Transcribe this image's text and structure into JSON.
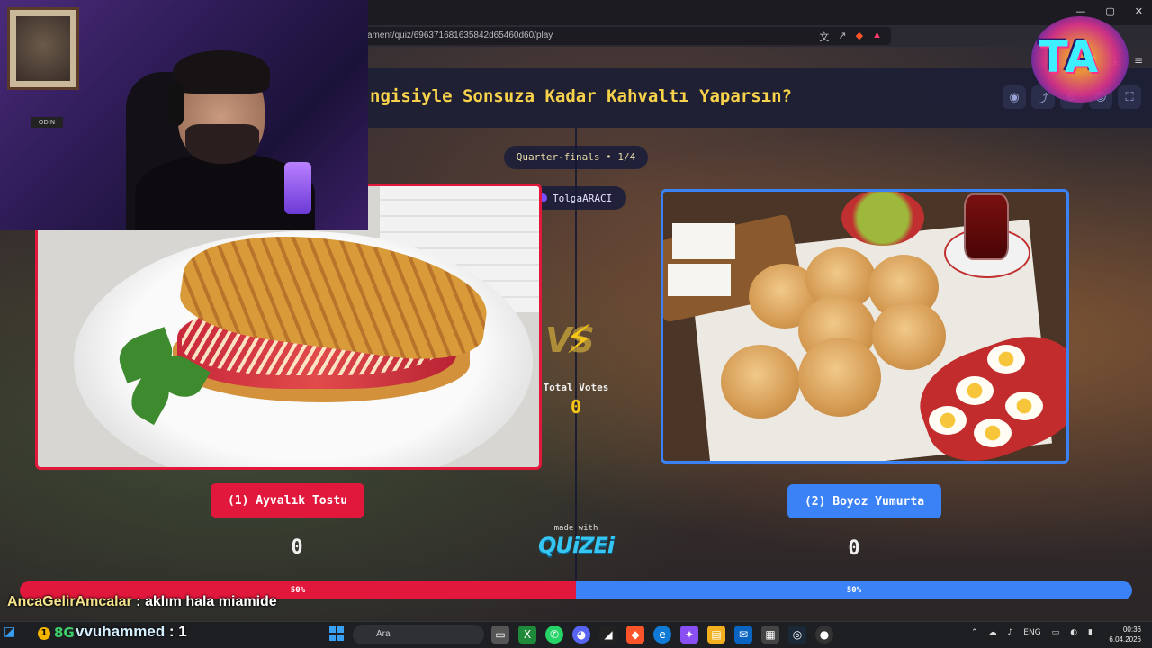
{
  "browser": {
    "url": "ament/quiz/696371681635842d65460d60/play",
    "icons": [
      "translate-icon",
      "share-icon",
      "brave-icon",
      "triangle-icon"
    ],
    "window_controls": [
      "—",
      "▢",
      "✕"
    ]
  },
  "quiz": {
    "title": "ngisiyle Sonsuza Kadar Kahvaltı Yaparsın?",
    "round": "Quarter-finals • 1/4",
    "user": "TolgaARACI",
    "total_votes_label": "Total Votes",
    "total_votes": "0",
    "made_with": "made with",
    "brand": "QUiZEi",
    "options": [
      {
        "label": "(1) Ayvalık Tostu",
        "score": "0",
        "percent": "50%",
        "color": "#e1183c"
      },
      {
        "label": "(2) Boyoz Yumurta",
        "score": "0",
        "percent": "50%",
        "color": "#3b82f6"
      }
    ]
  },
  "chat": [
    {
      "user": "AncaGelirAmcalar",
      "message": " : aklım hala miamide"
    },
    {
      "user": "vvuhammed",
      "message": " : 1"
    }
  ],
  "cam": {
    "sign": "ODIN"
  },
  "taskbar": {
    "search_placeholder": "Ara",
    "badge": "1",
    "tag": "8G",
    "lang": "ENG",
    "time": "00:36",
    "date": "6.04.2026"
  },
  "logo": {
    "text": "TA"
  }
}
